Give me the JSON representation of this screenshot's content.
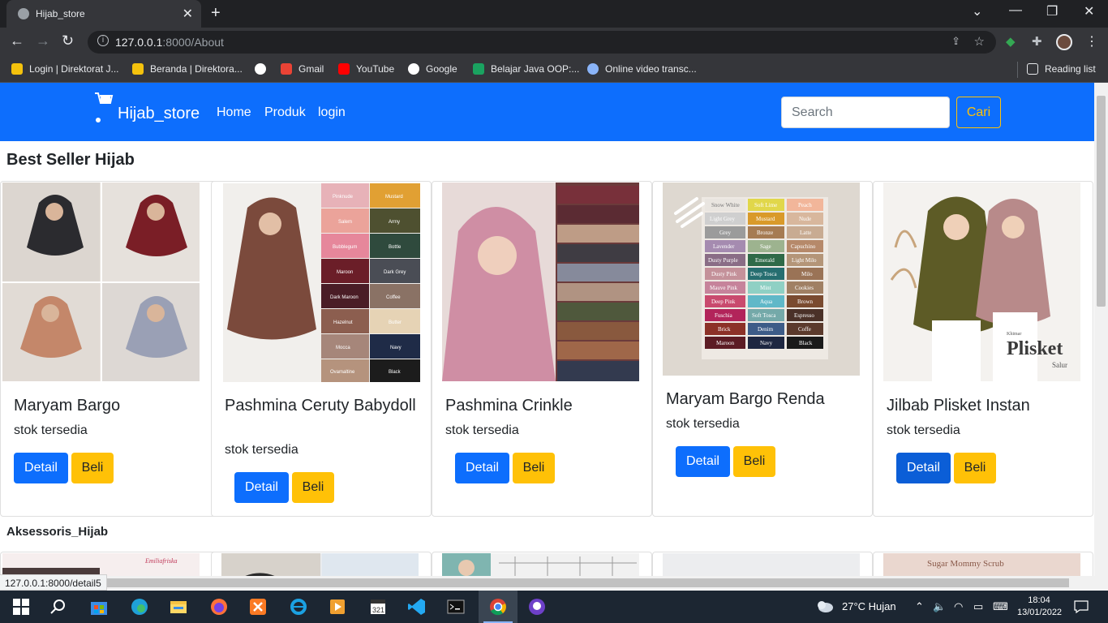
{
  "browser": {
    "tab_title": "Hijab_store",
    "url_host": "127.0.0.1",
    "url_rest": ":8000/About",
    "bookmarks": [
      "Login | Direktorat J...",
      "Beranda | Direktora...",
      "Gmail",
      "YouTube",
      "Google",
      "Belajar Java OOP:...",
      "Online video transc..."
    ],
    "reading_list": "Reading list",
    "status_url": "127.0.0.1:8000/detail5"
  },
  "site": {
    "brand": "Hijab_store",
    "nav": [
      "Home",
      "Produk",
      "login"
    ],
    "search_placeholder": "Search",
    "search_button": "Cari"
  },
  "sections": {
    "best_seller": "Best Seller Hijab",
    "accessories": "Aksessoris_Hijab"
  },
  "products": [
    {
      "name": "Maryam Bargo",
      "stock": "stok tersedia",
      "detail": "Detail",
      "buy": "Beli"
    },
    {
      "name": "Pashmina Ceruty Babydoll",
      "stock": "stok tersedia",
      "detail": "Detail",
      "buy": "Beli"
    },
    {
      "name": "Pashmina Crinkle",
      "stock": "stok tersedia",
      "detail": "Detail",
      "buy": "Beli"
    },
    {
      "name": "Maryam Bargo Renda",
      "stock": "stok tersedia",
      "detail": "Detail",
      "buy": "Beli"
    },
    {
      "name": "Jilbab Plisket Instan",
      "stock": "stok tersedia",
      "detail": "Detail",
      "buy": "Beli"
    }
  ],
  "product_images": {
    "p2_labels": [
      "Pinknude",
      "Mustard",
      "Salem",
      "Army",
      "Bubblegum",
      "Bottle",
      "Maroon",
      "Dark Grey",
      "Dark Maroon",
      "Coffee",
      "Hazelnut",
      "Butter",
      "Mocca",
      "Navy",
      "Ovamaltine",
      "Black"
    ],
    "p4_labels": [
      "Snow White",
      "Soft Lime",
      "Peach",
      "Light Grey",
      "Mustard",
      "Nude",
      "Grey",
      "Bronze",
      "Latte",
      "Lavender",
      "Sage",
      "Capuchino",
      "Dusty Purple",
      "Emerald",
      "Light Milo",
      "Dusty Pink",
      "Deep Tosca",
      "Milo",
      "Mauve Pink",
      "Mint",
      "Cookies",
      "Deep Pink",
      "Aqua",
      "Brown",
      "Fuschia",
      "Soft Tosca",
      "Espresso",
      "Brick",
      "Denim",
      "Coffe",
      "Maroon",
      "Navy",
      "Black"
    ],
    "p5_title": "Plisket",
    "p5_sub": "Salur",
    "p5_caption": "Khimar",
    "acc1": "Emiliafriska",
    "acc5": "Sugar Mommy Scrub"
  },
  "taskbar": {
    "weather": "27°C  Hujan",
    "time": "18:04",
    "date": "13/01/2022"
  },
  "colors": {
    "primary": "#0d6efd",
    "warning": "#ffc107",
    "chrome_dark": "#202124",
    "taskbar": "#1c2632"
  }
}
